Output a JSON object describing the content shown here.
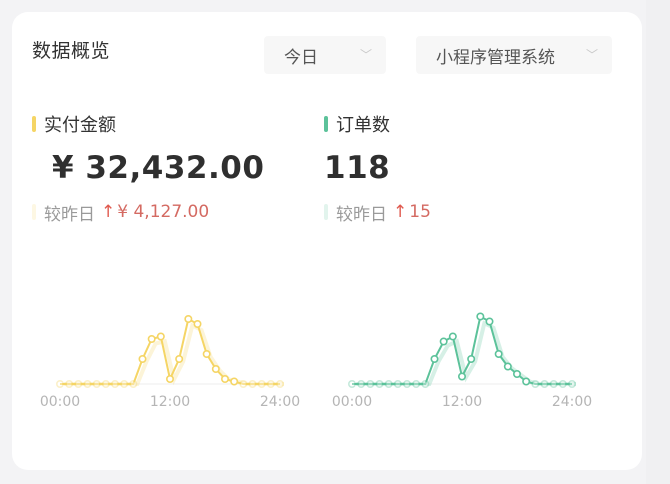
{
  "card": {
    "title": "数据概览"
  },
  "filters": {
    "period": {
      "selected": "今日"
    },
    "system": {
      "selected": "小程序管理系统"
    }
  },
  "metrics": [
    {
      "label": "实付金额",
      "value": "¥ 32,432.00",
      "compare_label": "较昨日",
      "compare_arrow": "↑",
      "compare_value": "¥ 4,127.00",
      "color": "#f5d565"
    },
    {
      "label": "订单数",
      "value": "118",
      "compare_label": "较昨日",
      "compare_arrow": "↑",
      "compare_value": "15",
      "color": "#5cc29a"
    }
  ],
  "chart_data": [
    {
      "type": "line",
      "series_color": "#f5d565",
      "x_ticks": [
        "00:00",
        "12:00",
        "24:00"
      ],
      "x": [
        0,
        1,
        2,
        3,
        4,
        5,
        6,
        7,
        8,
        9,
        10,
        11,
        12,
        13,
        14,
        15,
        16,
        17,
        18,
        19,
        20,
        21,
        22,
        23,
        24
      ],
      "values": [
        0,
        0,
        0,
        0,
        0,
        0,
        0,
        0,
        0,
        0.5,
        0.9,
        0.95,
        0.1,
        0.5,
        1.3,
        1.2,
        0.6,
        0.3,
        0.1,
        0.05,
        0,
        0,
        0,
        0,
        0
      ],
      "ylim": [
        0,
        1.4
      ]
    },
    {
      "type": "line",
      "series_color": "#5cc29a",
      "x_ticks": [
        "00:00",
        "12:00",
        "24:00"
      ],
      "x": [
        0,
        1,
        2,
        3,
        4,
        5,
        6,
        7,
        8,
        9,
        10,
        11,
        12,
        13,
        14,
        15,
        16,
        17,
        18,
        19,
        20,
        21,
        22,
        23,
        24
      ],
      "values": [
        0,
        0,
        0,
        0,
        0,
        0,
        0,
        0,
        0,
        0.5,
        0.85,
        0.95,
        0.15,
        0.5,
        1.35,
        1.25,
        0.6,
        0.35,
        0.2,
        0.05,
        0,
        0,
        0,
        0,
        0
      ],
      "ylim": [
        0,
        1.4
      ]
    }
  ]
}
